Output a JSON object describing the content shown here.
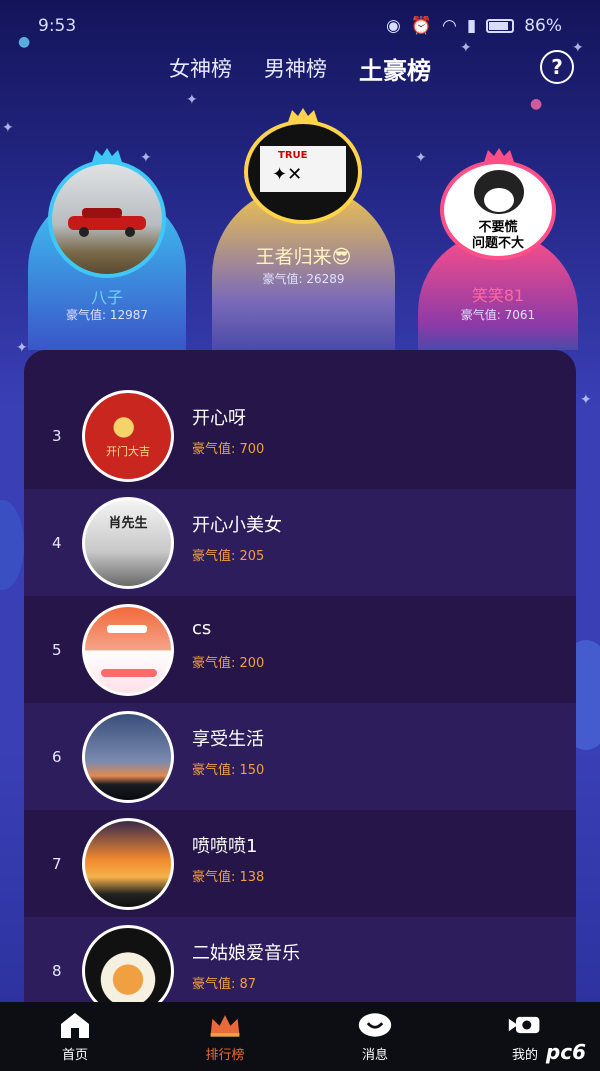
{
  "status_bar": {
    "time": "9:53",
    "battery": "86%"
  },
  "tabs": [
    {
      "label": "女神榜",
      "active": false
    },
    {
      "label": "男神榜",
      "active": false
    },
    {
      "label": "土豪榜",
      "active": true
    }
  ],
  "help_label": "?",
  "podium": {
    "first": {
      "name": "王者归来😎",
      "value_label": "豪气值:",
      "value": "26289"
    },
    "second": {
      "name": "八子",
      "value_label": "豪气值:",
      "value": "12987"
    },
    "third": {
      "name": "笑笑81",
      "value_label": "豪气值:",
      "value": "7061"
    }
  },
  "avatar_captions": {
    "first": "TRUE",
    "third_line1": "不要慌",
    "third_line2": "问题不大",
    "rank3": "开门大吉",
    "rank4": "肖先生"
  },
  "ranking": [
    {
      "rank": "3",
      "name": "开心呀",
      "value": "豪气值: 700"
    },
    {
      "rank": "4",
      "name": "开心小美女",
      "value": "豪气值: 205"
    },
    {
      "rank": "5",
      "name": "cs",
      "value": "豪气值: 200"
    },
    {
      "rank": "6",
      "name": "享受生活",
      "value": "豪气值: 150"
    },
    {
      "rank": "7",
      "name": "喷喷喷1",
      "value": "豪气值: 138"
    },
    {
      "rank": "8",
      "name": "二姑娘爱音乐",
      "value": "豪气值: 87"
    }
  ],
  "nav": [
    {
      "label": "首页",
      "icon": "home-icon",
      "active": false
    },
    {
      "label": "排行榜",
      "icon": "crown-icon",
      "active": true
    },
    {
      "label": "消息",
      "icon": "message-icon",
      "active": false
    },
    {
      "label": "我的",
      "icon": "camera-icon",
      "active": false
    }
  ],
  "watermark": "pc6",
  "colors": {
    "accent": "#e86a3a",
    "value_orange": "#f0a040",
    "gold": "#ffd34a",
    "cyan": "#3fc8f5",
    "pink": "#ff4f88"
  }
}
